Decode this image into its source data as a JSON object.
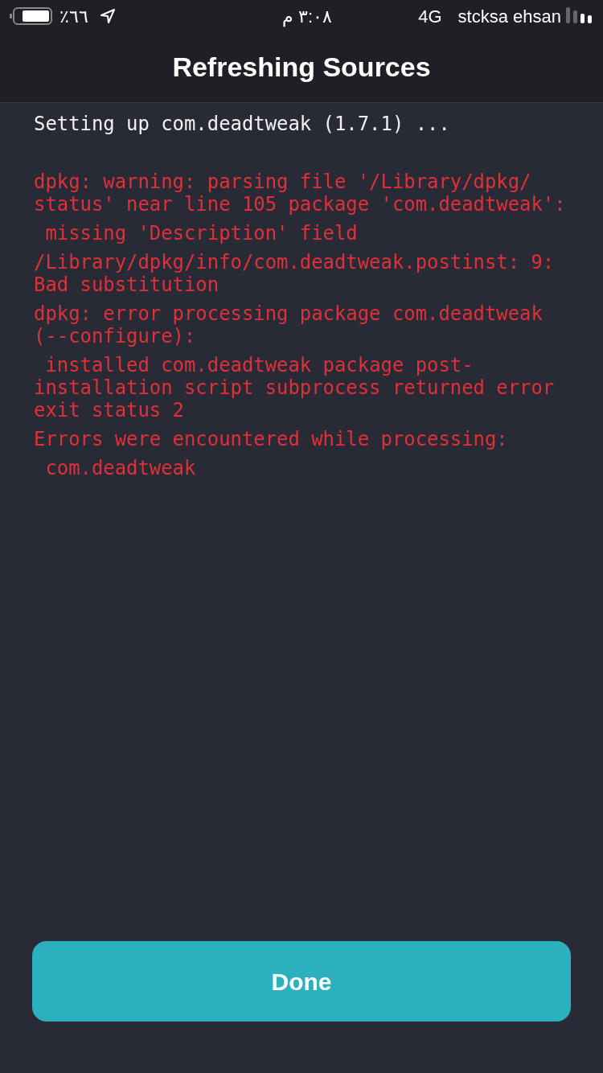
{
  "status_bar": {
    "battery": "٪٦٦",
    "time": "٣:٠٨ م",
    "network": "4G",
    "carrier": "stcksa ehsan"
  },
  "nav": {
    "title": "Refreshing Sources"
  },
  "log": [
    {
      "kind": "info",
      "text": "Setting up com.deadtweak (1.7.1) ..."
    },
    {
      "kind": "error",
      "text": "dpkg: warning: parsing file '/Library/dpkg/\nstatus' near line 105 package 'com.deadtweak':"
    },
    {
      "kind": "error",
      "text": " missing 'Description' field"
    },
    {
      "kind": "error",
      "text": "/Library/dpkg/info/com.deadtweak.postinst: 9:\nBad substitution"
    },
    {
      "kind": "error",
      "text": "dpkg: error processing package com.deadtweak\n(--configure):"
    },
    {
      "kind": "error",
      "text": " installed com.deadtweak package post-\ninstallation script subprocess returned error\nexit status 2"
    },
    {
      "kind": "error",
      "text": "Errors were encountered while processing:"
    },
    {
      "kind": "error",
      "text": " com.deadtweak"
    }
  ],
  "button": {
    "label": "Done"
  }
}
